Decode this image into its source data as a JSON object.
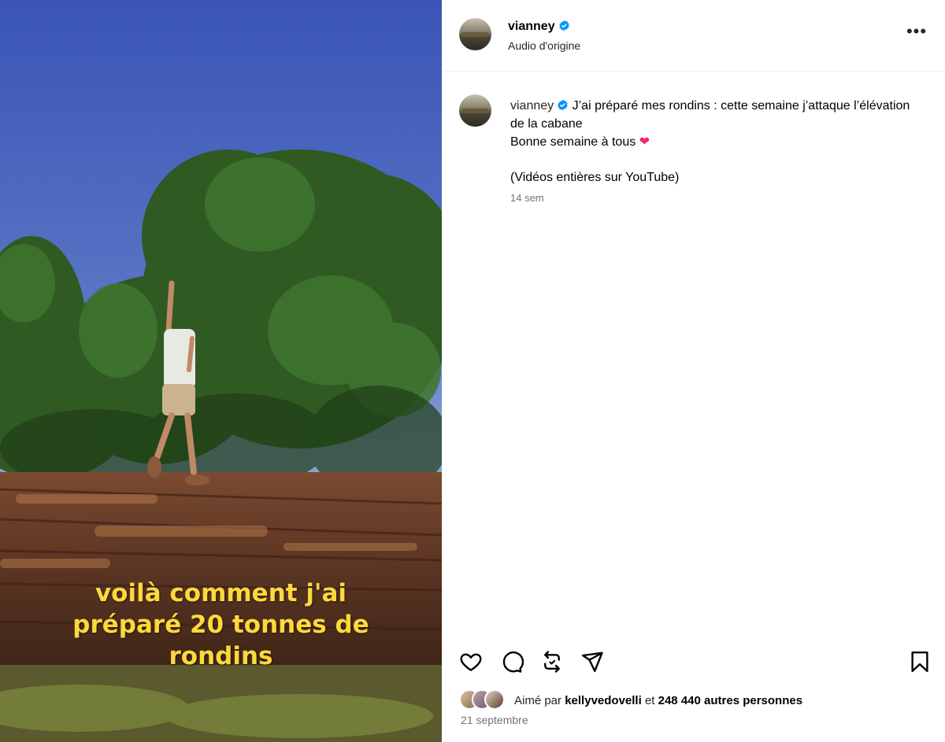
{
  "video": {
    "caption_lines": [
      "voilà comment j'ai",
      "préparé 20 tonnes de",
      "rondins"
    ]
  },
  "header": {
    "username": "vianney",
    "audio": "Audio d'origine",
    "more_label": "•••"
  },
  "post": {
    "username": "vianney",
    "caption_line1": "J’ai préparé mes rondins : cette semaine j’attaque l’élévation de la cabane",
    "caption_line2": "Bonne semaine à tous",
    "caption_emoji": "❤",
    "caption_line3": "(Vidéos entières sur YouTube)",
    "time": "14 sem"
  },
  "likes": {
    "prefix": "Aimé par",
    "user": "kellyvedovelli",
    "conj": "et",
    "count_text": "248 440 autres personnes"
  },
  "date": "21 septembre",
  "colors": {
    "verified": "#0095f6",
    "heart": "#ee2a6b",
    "caption_overlay": "#ffd83a"
  }
}
